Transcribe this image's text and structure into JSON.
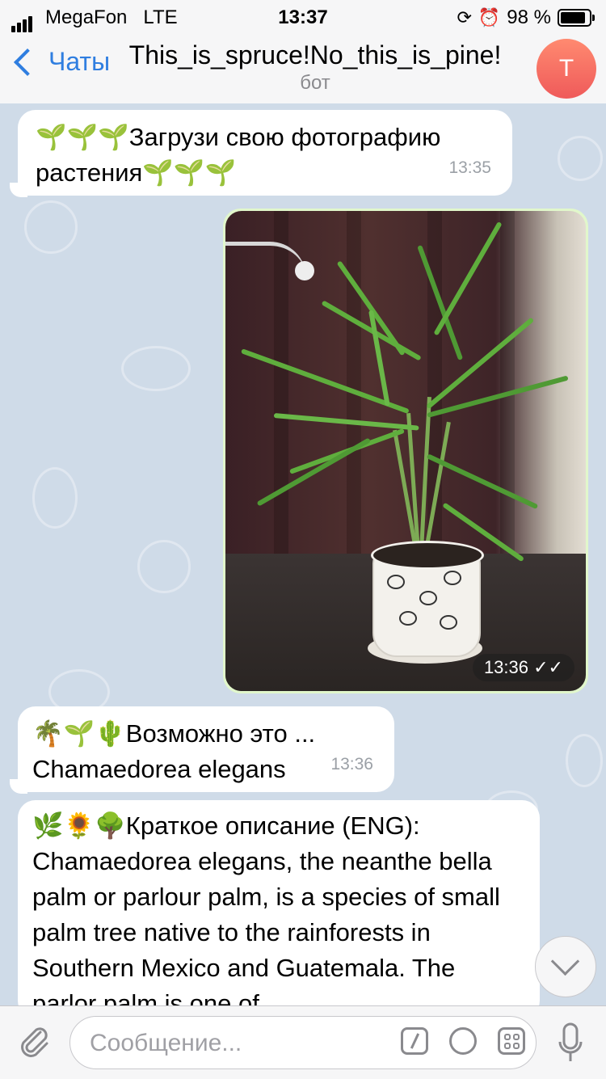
{
  "status_bar": {
    "carrier": "MegaFon",
    "network": "LTE",
    "time": "13:37",
    "battery": "98 %",
    "icons": [
      "signal-icon",
      "orientation-lock-icon",
      "alarm-icon",
      "battery-icon"
    ]
  },
  "header": {
    "back_label": "Чаты",
    "title": "This_is_spruce!No_this_is_pine!",
    "subtitle": "бот",
    "avatar_letter": "T",
    "avatar_colors": [
      "#ff8a70",
      "#ef5a5a"
    ],
    "accent": "#2f7ee0"
  },
  "messages": [
    {
      "emoji_prefix": "🌱🌱🌱",
      "text_line1": "Загрузи свою фотографию",
      "text_line2": "растения",
      "emoji_suffix": "🌱🌱🌱",
      "time": "13:35"
    },
    {
      "type": "photo",
      "time": "13:36",
      "status": "read"
    },
    {
      "emoji_prefix": "🌴🌱🌵",
      "text_line1": "Возможно это ...",
      "text_line2": "Chamaedorea elegans",
      "time": "13:36"
    },
    {
      "emoji_prefix": "🌿🌻🌳",
      "heading": "Краткое описание (ENG):",
      "body": "Chamaedorea elegans, the neanthe bella palm or parlour palm, is a species of small palm tree native to the rainforests in Southern Mexico and Guatemala. The parlor palm is one of"
    }
  ],
  "input": {
    "placeholder": "Сообщение..."
  }
}
